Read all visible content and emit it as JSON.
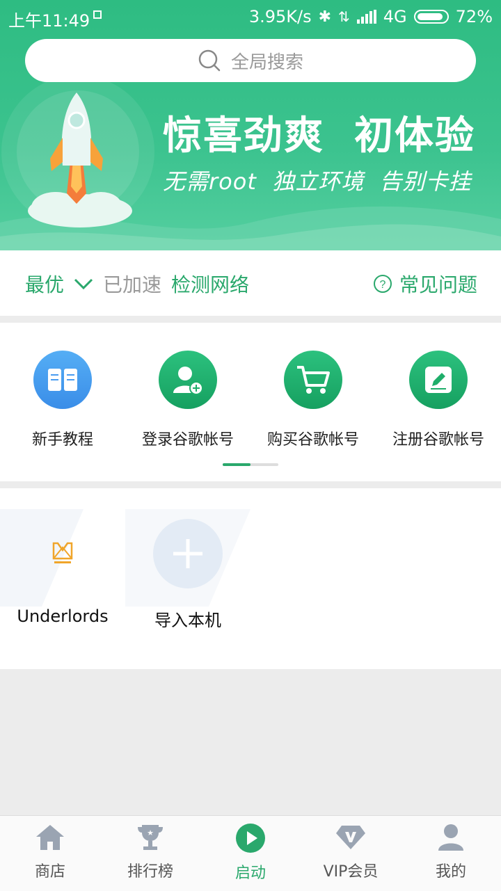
{
  "status_bar": {
    "time": "上午11:49",
    "speed": "3.95K/s",
    "network": "4G",
    "battery": "72%"
  },
  "search": {
    "placeholder": "全局搜索"
  },
  "banner": {
    "title": "惊喜劲爽  初体验",
    "subtitle": "无需root  独立环境  告别卡挂"
  },
  "accel_bar": {
    "mode": "最优",
    "status": "已加速",
    "detect": "检测网络",
    "faq": "常见问题"
  },
  "quick_tiles": [
    {
      "label": "新手教程",
      "icon": "book-icon",
      "color": "#4a9cf0"
    },
    {
      "label": "登录谷歌帐号",
      "icon": "user-add-icon",
      "color": "#1fae6a"
    },
    {
      "label": "购买谷歌帐号",
      "icon": "cart-icon",
      "color": "#1fae6a"
    },
    {
      "label": "注册谷歌帐号",
      "icon": "edit-icon",
      "color": "#1fae6a"
    }
  ],
  "apps": [
    {
      "label": "Underlords",
      "icon": "underlords-logo"
    },
    {
      "label": "导入本机",
      "icon": "plus-icon"
    }
  ],
  "bottom_nav": [
    {
      "label": "商店",
      "icon": "home-icon"
    },
    {
      "label": "排行榜",
      "icon": "trophy-icon"
    },
    {
      "label": "启动",
      "icon": "play-icon",
      "active": true
    },
    {
      "label": "VIP会员",
      "icon": "diamond-icon"
    },
    {
      "label": "我的",
      "icon": "person-icon"
    }
  ],
  "colors": {
    "accent": "#2aa86c",
    "header": "#34c087"
  }
}
